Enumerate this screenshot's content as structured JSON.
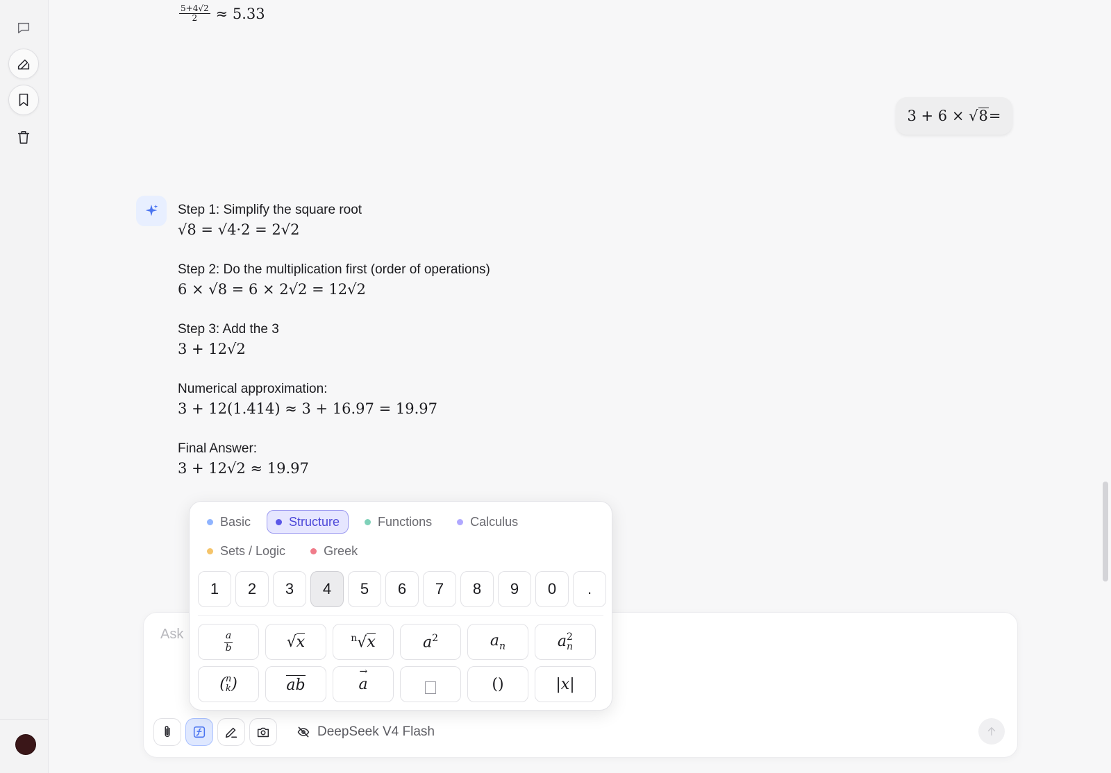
{
  "sidebar": {
    "items": [
      {
        "name": "conversations",
        "icon": "chat-bubble-icon"
      },
      {
        "name": "new-chat",
        "icon": "edit-icon"
      },
      {
        "name": "bookmarks",
        "icon": "bookmark-icon"
      },
      {
        "name": "delete",
        "icon": "trash-icon"
      }
    ],
    "avatar_color": "#3a1618"
  },
  "chat": {
    "previous_result": {
      "numerator": "5+4√2",
      "denominator": "2",
      "approx": "≈ 5.33"
    },
    "user_message": {
      "lhs": "3 + 6 ×",
      "radicand": "8",
      "suffix": "="
    },
    "assistant": {
      "steps": [
        {
          "label": "Step 1: Simplify the square root",
          "math": "√8 = √4·2 = 2√2"
        },
        {
          "label": "Step 2: Do the multiplication first (order of operations)",
          "math": "6 × √8 = 6 × 2√2 = 12√2"
        },
        {
          "label": "Step 3: Add the 3",
          "math": "3 + 12√2"
        },
        {
          "label": "Numerical approximation:",
          "math": "3 + 12(1.414) ≈ 3 + 16.97 = 19.97"
        },
        {
          "label": "Final Answer:",
          "math": "3 + 12√2 ≈ 19.97"
        }
      ]
    }
  },
  "keyboard": {
    "categories": [
      {
        "label": "Basic",
        "color": "#8fb4ff",
        "active": false
      },
      {
        "label": "Structure",
        "color": "#5b57e8",
        "active": true
      },
      {
        "label": "Functions",
        "color": "#7fd1b9",
        "active": false
      },
      {
        "label": "Calculus",
        "color": "#b0a8ff",
        "active": false
      },
      {
        "label": "Sets / Logic",
        "color": "#f5c46a",
        "active": false
      },
      {
        "label": "Greek",
        "color": "#f07c8a",
        "active": false
      }
    ],
    "digits": [
      "1",
      "2",
      "3",
      "4",
      "5",
      "6",
      "7",
      "8",
      "9",
      "0",
      "."
    ],
    "pressed_digit": "4",
    "templates": [
      "a/b",
      "√x",
      "ⁿ√x",
      "a²",
      "aₙ",
      "aₙ²",
      "(n k)",
      "ab̄",
      "a⃗",
      "□",
      "()",
      "|x|"
    ]
  },
  "input": {
    "placeholder": "Ask",
    "model_name": "DeepSeek V4 Flash"
  },
  "accent": "#4c47d8"
}
